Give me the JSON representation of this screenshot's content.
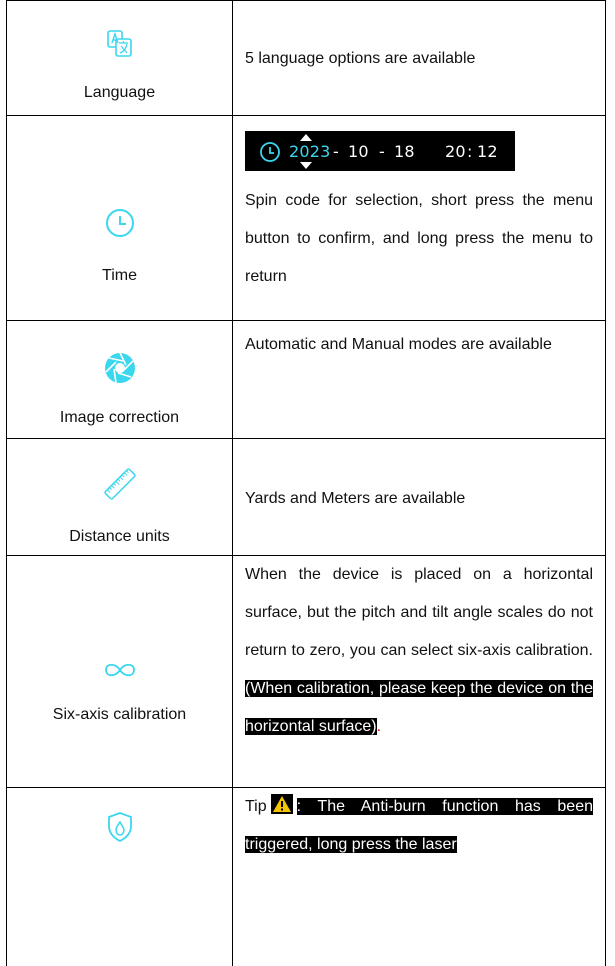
{
  "rows": [
    {
      "label": "Language",
      "icon": "language-icon",
      "text": "5 language options are available"
    },
    {
      "label": "Time",
      "icon": "clock-icon",
      "time_year": "2023",
      "time_month": "10",
      "time_day": "18",
      "time_hour": "20",
      "time_minute": "12",
      "time_sep": "-",
      "time_colon": ":",
      "text": "Spin code for selection, short press the menu button to confirm, and long press the menu to return"
    },
    {
      "label": "Image correction",
      "icon": "shutter-icon",
      "text": "Automatic and Manual modes are available"
    },
    {
      "label": "Distance units",
      "icon": "ruler-icon",
      "text": "Yards and Meters are available"
    },
    {
      "label": "Six-axis calibration",
      "icon": "infinity-icon",
      "text": "When the device is placed on a horizontal surface, but the pitch and tilt angle scales do not return to zero, you can select six-axis calibration.",
      "note": "(When calibration, please keep the device on the horizontal surface)",
      "note_end": "."
    },
    {
      "icon": "shield-flame-icon",
      "tip_label": "Tip",
      "tip_icon": "warning-icon",
      "tip_text": ": The Anti-burn function has been triggered, long press the laser"
    }
  ],
  "colors": {
    "icon_accent": "#3ad7ef",
    "highlight_bg": "#000000",
    "note_end": "#d40000"
  }
}
